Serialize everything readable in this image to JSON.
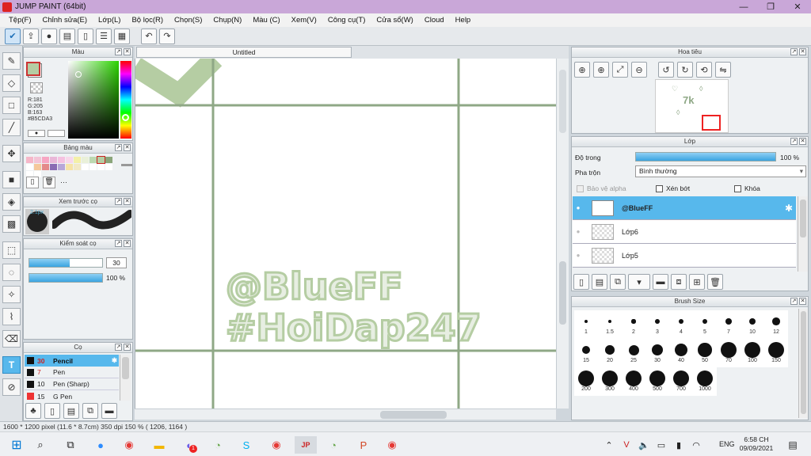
{
  "window": {
    "title": "JUMP PAINT (64bit)",
    "min": "—",
    "max": "❐",
    "close": "✕"
  },
  "menu": [
    "Tệp(F)",
    "Chỉnh sửa(E)",
    "Lớp(L)",
    "Bộ lọc(R)",
    "Chọn(S)",
    "Chụp(N)",
    "Màu (C)",
    "Xem(V)",
    "Công cụ(T)",
    "Cửa sổ(W)",
    "Cloud",
    "Help"
  ],
  "toolbar_icons": [
    "select-check-icon",
    "export-icon",
    "chat-icon",
    "comment-icon",
    "page-icon",
    "list-icon",
    "grid-icon",
    "undo-icon",
    "redo-icon"
  ],
  "color_panel": {
    "title": "Màu",
    "r": "R:181",
    "g": "G:205",
    "b": "B:163",
    "hex": "#B5CDA3",
    "main_color": "#b5cda3"
  },
  "palette_panel": {
    "title": "Bảng màu",
    "more": "···",
    "swatches": [
      "#f6b7c9",
      "#f3c4d6",
      "#f7a6c3",
      "#e9b7d8",
      "#f5c1e0",
      "#f8d7ea",
      "#f4f0a8",
      "#e9f0d9",
      "#bcd8b0",
      "#b5cda3",
      "#8aa57a",
      "#ffffff",
      "#f5c89b",
      "#e48a8a",
      "#8a6bb3",
      "#b7a7d8",
      "#f6e3a6",
      "#f2e9c6",
      "#ffffff",
      "#ffffff",
      "#ffffff",
      "#ffffff",
      "#ffffff",
      "#ffffff"
    ]
  },
  "brush_preview": {
    "title": "Xem trước cọ",
    "size_label": "2.1px"
  },
  "brush_control": {
    "title": "Kiểm soát cọ",
    "size_value": "30",
    "opacity_value": "100 %",
    "size_fill": 0.55,
    "opacity_fill": 1.0
  },
  "brush_list": {
    "title": "Cọ",
    "items": [
      {
        "size": "30",
        "name": "Pencil",
        "selected": true,
        "color": "#111"
      },
      {
        "size": "7",
        "name": "Pen",
        "selected": false,
        "color": "#111"
      },
      {
        "size": "10",
        "name": "Pen (Sharp)",
        "selected": false,
        "color": "#111"
      },
      {
        "size": "15",
        "name": "G Pen",
        "selected": false,
        "color": "#e33"
      }
    ]
  },
  "canvas": {
    "tab_title": "Untitled",
    "watermark_line1": "@BlueFF",
    "watermark_line2": "#HoiDap247",
    "grid_color": "#8fa886",
    "text_color": "#e7eee2",
    "outline_color": "#b5cda3"
  },
  "navigator": {
    "title": "Hoa tiêu",
    "mini_text": "7k"
  },
  "layer_panel": {
    "title": "Lớp",
    "opacity_label": "Độ trong",
    "opacity_value": "100 %",
    "blend_label": "Pha trộn",
    "blend_value": "Bình thường",
    "protect_alpha": "Bảo vệ alpha",
    "clipping": "Xén bớt",
    "lock": "Khóa",
    "layers": [
      {
        "name": "@BlueFF",
        "selected": true
      },
      {
        "name": "Lớp6",
        "selected": false
      },
      {
        "name": "Lớp5",
        "selected": false
      }
    ]
  },
  "brush_size": {
    "title": "Brush Size",
    "sizes": [
      "1",
      "1.5",
      "2",
      "3",
      "4",
      "5",
      "7",
      "10",
      "12",
      "15",
      "20",
      "25",
      "30",
      "40",
      "50",
      "70",
      "100",
      "150",
      "200",
      "300",
      "400",
      "500",
      "700",
      "1000"
    ]
  },
  "status": {
    "text": "1600 * 1200 pixel   (11.6 * 8.7cm)   350 dpi   150 %   ( 1206, 1164 )"
  },
  "taskbar": {
    "lang": "ENG",
    "time": "6:58 CH",
    "date": "09/09/2021",
    "badge": "1"
  }
}
